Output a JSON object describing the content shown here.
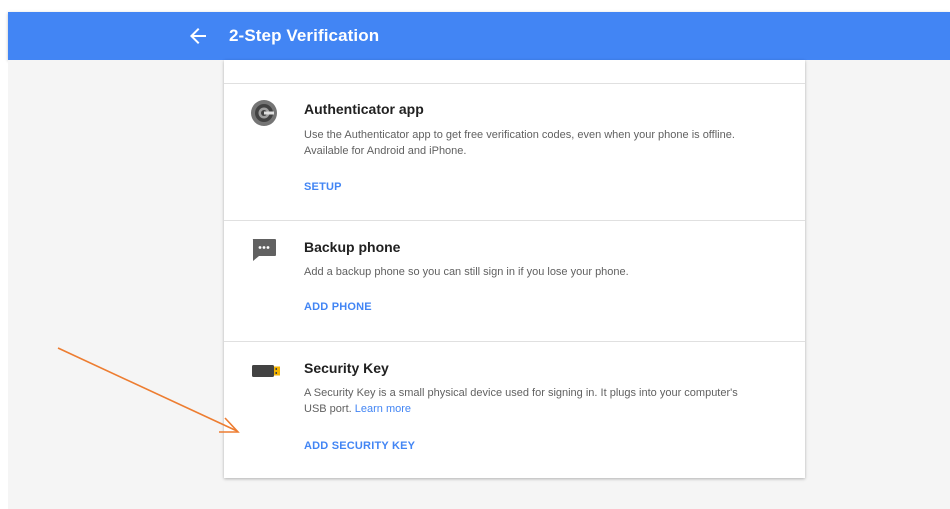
{
  "header": {
    "back_icon": "arrow-back-icon",
    "title": "2-Step Verification"
  },
  "sections": [
    {
      "icon": "authenticator-app-icon",
      "title": "Authenticator app",
      "description_line1": "Use the Authenticator app to get free verification codes, even when your phone is offline.",
      "description_line2": "Available for Android and iPhone.",
      "action": "SETUP"
    },
    {
      "icon": "sms-message-icon",
      "title": "Backup phone",
      "description_line1": "Add a backup phone so you can still sign in if you lose your phone.",
      "action": "ADD PHONE"
    },
    {
      "icon": "usb-security-key-icon",
      "title": "Security Key",
      "description_line1": "A Security Key is a small physical device used for signing in. It plugs into your computer's",
      "description_line2": "USB port.",
      "link": "Learn more",
      "action": "ADD SECURITY KEY"
    }
  ],
  "colors": {
    "header_blue": "#4285f4",
    "link_blue": "#4285f4",
    "annotation_arrow": "#ed7d31"
  },
  "annotation": {
    "type": "arrow",
    "points_to": "ADD SECURITY KEY"
  }
}
